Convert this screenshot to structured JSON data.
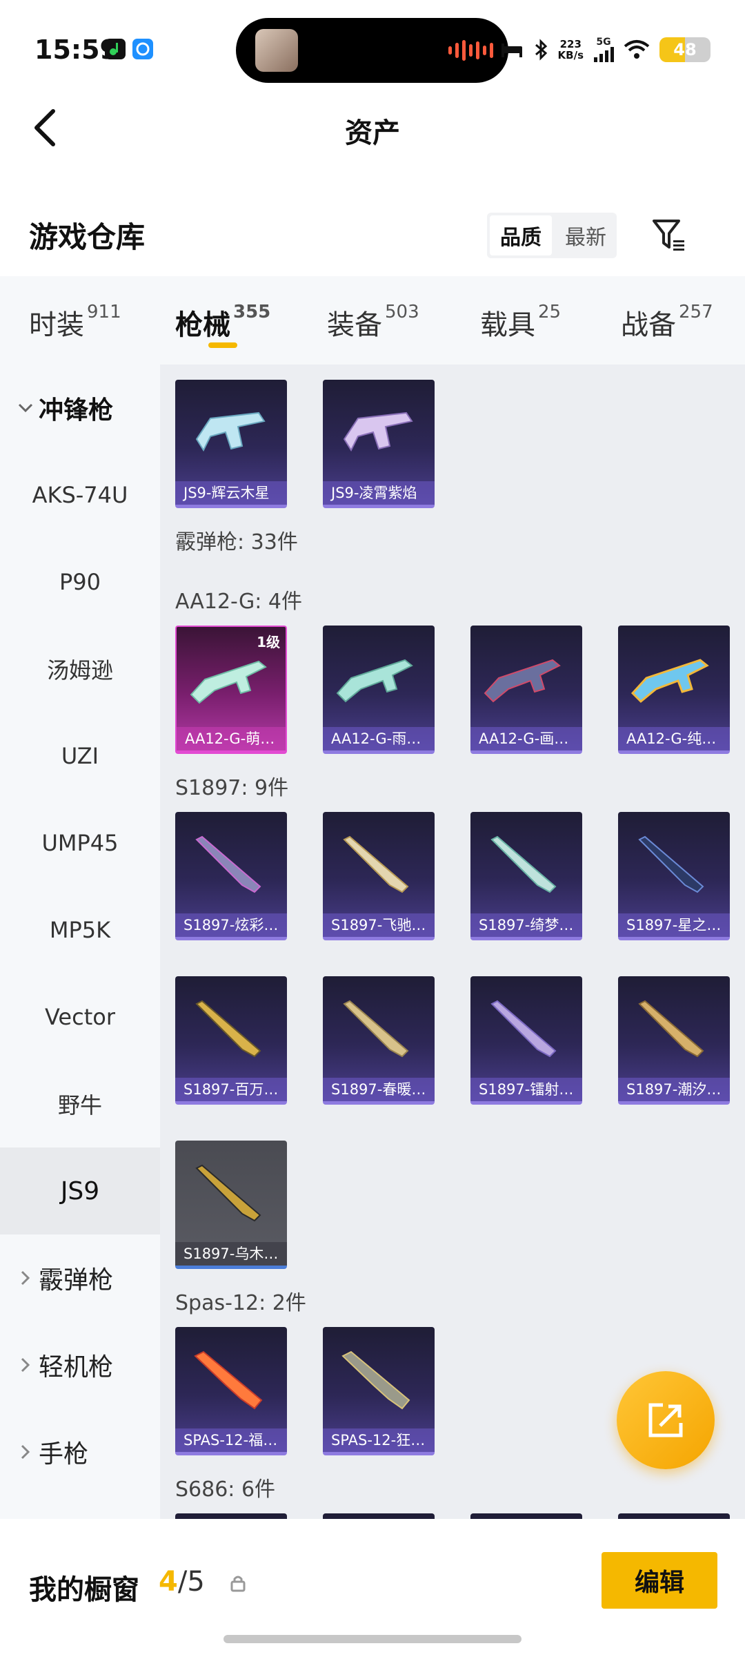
{
  "status_bar": {
    "time": "15:59",
    "net_speed": "223",
    "net_unit": "KB/s",
    "signal": "5G",
    "battery": "48"
  },
  "header": {
    "title": "资产",
    "back_icon": "chevron-left-icon"
  },
  "warehouse": {
    "title": "游戏仓库",
    "sort_options": [
      "品质",
      "最新"
    ],
    "active_sort": "品质",
    "filter_icon": "filter-icon"
  },
  "tabs": [
    {
      "label": "时装",
      "count": "911"
    },
    {
      "label": "枪械",
      "count": "355",
      "active": true
    },
    {
      "label": "装备",
      "count": "503"
    },
    {
      "label": "载具",
      "count": "25"
    },
    {
      "label": "战备",
      "count": "257"
    }
  ],
  "sidebar": {
    "group_open": "冲锋枪",
    "items": [
      "AKS-74U",
      "P90",
      "汤姆逊",
      "UZI",
      "UMP45",
      "MP5K",
      "Vector",
      "野牛",
      "JS9"
    ],
    "active_item": "JS9",
    "groups_collapsed": [
      "霰弹枪",
      "轻机枪",
      "手枪"
    ]
  },
  "main": {
    "js9_cards": [
      "JS9-辉云木星",
      "JS9-凌霄紫焰"
    ],
    "shotgun_header": "霰弹枪: 33件",
    "aa12_header": "AA12-G: 4件",
    "aa12_cards": [
      "AA12-G-萌…",
      "AA12-G-雨…",
      "AA12-G-画…",
      "AA12-G-纯…"
    ],
    "aa12_first_level": "1级",
    "s1897_header": "S1897: 9件",
    "s1897_cards": [
      "S1897-炫彩…",
      "S1897-飞驰…",
      "S1897-绮梦…",
      "S1897-星之…",
      "S1897-百万…",
      "S1897-春暖…",
      "S1897-镭射…",
      "S1897-潮汐…",
      "S1897-乌木…"
    ],
    "spas_header": "Spas-12: 2件",
    "spas_cards": [
      "SPAS-12-福…",
      "SPAS-12-狂…"
    ],
    "s686_header": "S686: 6件"
  },
  "fab": {
    "icon": "share-external-icon"
  },
  "bottom": {
    "title": "我的橱窗",
    "current": "4",
    "separator": "/",
    "max": "5",
    "lock_icon": "lock-icon",
    "edit_label": "编辑"
  },
  "colors": {
    "accent": "#f5b800",
    "card_border": "#8e7be0",
    "pink_border": "#e24bd2"
  }
}
